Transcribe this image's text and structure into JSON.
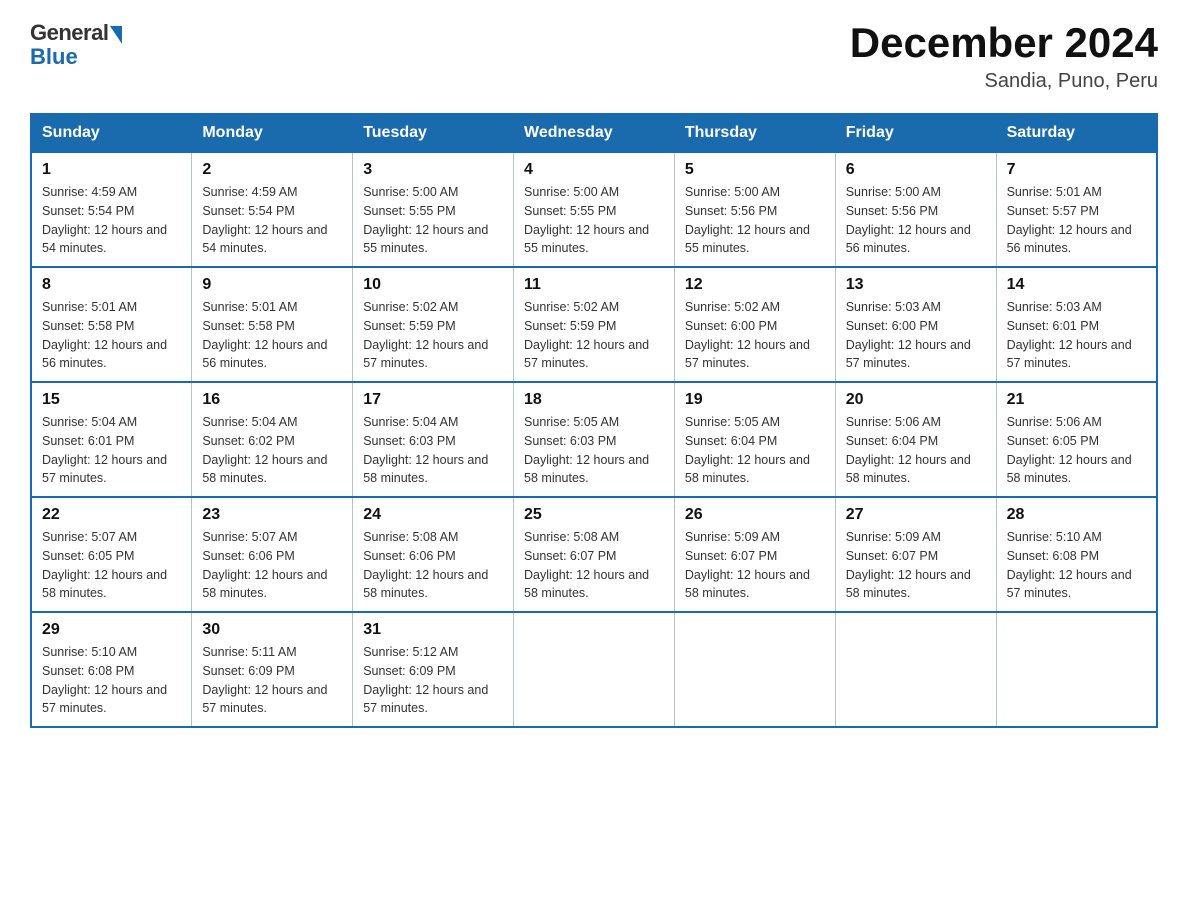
{
  "logo": {
    "text_general": "General",
    "text_blue": "Blue"
  },
  "title": "December 2024",
  "subtitle": "Sandia, Puno, Peru",
  "days_of_week": [
    "Sunday",
    "Monday",
    "Tuesday",
    "Wednesday",
    "Thursday",
    "Friday",
    "Saturday"
  ],
  "weeks": [
    [
      {
        "day": "1",
        "sunrise": "Sunrise: 4:59 AM",
        "sunset": "Sunset: 5:54 PM",
        "daylight": "Daylight: 12 hours and 54 minutes."
      },
      {
        "day": "2",
        "sunrise": "Sunrise: 4:59 AM",
        "sunset": "Sunset: 5:54 PM",
        "daylight": "Daylight: 12 hours and 54 minutes."
      },
      {
        "day": "3",
        "sunrise": "Sunrise: 5:00 AM",
        "sunset": "Sunset: 5:55 PM",
        "daylight": "Daylight: 12 hours and 55 minutes."
      },
      {
        "day": "4",
        "sunrise": "Sunrise: 5:00 AM",
        "sunset": "Sunset: 5:55 PM",
        "daylight": "Daylight: 12 hours and 55 minutes."
      },
      {
        "day": "5",
        "sunrise": "Sunrise: 5:00 AM",
        "sunset": "Sunset: 5:56 PM",
        "daylight": "Daylight: 12 hours and 55 minutes."
      },
      {
        "day": "6",
        "sunrise": "Sunrise: 5:00 AM",
        "sunset": "Sunset: 5:56 PM",
        "daylight": "Daylight: 12 hours and 56 minutes."
      },
      {
        "day": "7",
        "sunrise": "Sunrise: 5:01 AM",
        "sunset": "Sunset: 5:57 PM",
        "daylight": "Daylight: 12 hours and 56 minutes."
      }
    ],
    [
      {
        "day": "8",
        "sunrise": "Sunrise: 5:01 AM",
        "sunset": "Sunset: 5:58 PM",
        "daylight": "Daylight: 12 hours and 56 minutes."
      },
      {
        "day": "9",
        "sunrise": "Sunrise: 5:01 AM",
        "sunset": "Sunset: 5:58 PM",
        "daylight": "Daylight: 12 hours and 56 minutes."
      },
      {
        "day": "10",
        "sunrise": "Sunrise: 5:02 AM",
        "sunset": "Sunset: 5:59 PM",
        "daylight": "Daylight: 12 hours and 57 minutes."
      },
      {
        "day": "11",
        "sunrise": "Sunrise: 5:02 AM",
        "sunset": "Sunset: 5:59 PM",
        "daylight": "Daylight: 12 hours and 57 minutes."
      },
      {
        "day": "12",
        "sunrise": "Sunrise: 5:02 AM",
        "sunset": "Sunset: 6:00 PM",
        "daylight": "Daylight: 12 hours and 57 minutes."
      },
      {
        "day": "13",
        "sunrise": "Sunrise: 5:03 AM",
        "sunset": "Sunset: 6:00 PM",
        "daylight": "Daylight: 12 hours and 57 minutes."
      },
      {
        "day": "14",
        "sunrise": "Sunrise: 5:03 AM",
        "sunset": "Sunset: 6:01 PM",
        "daylight": "Daylight: 12 hours and 57 minutes."
      }
    ],
    [
      {
        "day": "15",
        "sunrise": "Sunrise: 5:04 AM",
        "sunset": "Sunset: 6:01 PM",
        "daylight": "Daylight: 12 hours and 57 minutes."
      },
      {
        "day": "16",
        "sunrise": "Sunrise: 5:04 AM",
        "sunset": "Sunset: 6:02 PM",
        "daylight": "Daylight: 12 hours and 58 minutes."
      },
      {
        "day": "17",
        "sunrise": "Sunrise: 5:04 AM",
        "sunset": "Sunset: 6:03 PM",
        "daylight": "Daylight: 12 hours and 58 minutes."
      },
      {
        "day": "18",
        "sunrise": "Sunrise: 5:05 AM",
        "sunset": "Sunset: 6:03 PM",
        "daylight": "Daylight: 12 hours and 58 minutes."
      },
      {
        "day": "19",
        "sunrise": "Sunrise: 5:05 AM",
        "sunset": "Sunset: 6:04 PM",
        "daylight": "Daylight: 12 hours and 58 minutes."
      },
      {
        "day": "20",
        "sunrise": "Sunrise: 5:06 AM",
        "sunset": "Sunset: 6:04 PM",
        "daylight": "Daylight: 12 hours and 58 minutes."
      },
      {
        "day": "21",
        "sunrise": "Sunrise: 5:06 AM",
        "sunset": "Sunset: 6:05 PM",
        "daylight": "Daylight: 12 hours and 58 minutes."
      }
    ],
    [
      {
        "day": "22",
        "sunrise": "Sunrise: 5:07 AM",
        "sunset": "Sunset: 6:05 PM",
        "daylight": "Daylight: 12 hours and 58 minutes."
      },
      {
        "day": "23",
        "sunrise": "Sunrise: 5:07 AM",
        "sunset": "Sunset: 6:06 PM",
        "daylight": "Daylight: 12 hours and 58 minutes."
      },
      {
        "day": "24",
        "sunrise": "Sunrise: 5:08 AM",
        "sunset": "Sunset: 6:06 PM",
        "daylight": "Daylight: 12 hours and 58 minutes."
      },
      {
        "day": "25",
        "sunrise": "Sunrise: 5:08 AM",
        "sunset": "Sunset: 6:07 PM",
        "daylight": "Daylight: 12 hours and 58 minutes."
      },
      {
        "day": "26",
        "sunrise": "Sunrise: 5:09 AM",
        "sunset": "Sunset: 6:07 PM",
        "daylight": "Daylight: 12 hours and 58 minutes."
      },
      {
        "day": "27",
        "sunrise": "Sunrise: 5:09 AM",
        "sunset": "Sunset: 6:07 PM",
        "daylight": "Daylight: 12 hours and 58 minutes."
      },
      {
        "day": "28",
        "sunrise": "Sunrise: 5:10 AM",
        "sunset": "Sunset: 6:08 PM",
        "daylight": "Daylight: 12 hours and 57 minutes."
      }
    ],
    [
      {
        "day": "29",
        "sunrise": "Sunrise: 5:10 AM",
        "sunset": "Sunset: 6:08 PM",
        "daylight": "Daylight: 12 hours and 57 minutes."
      },
      {
        "day": "30",
        "sunrise": "Sunrise: 5:11 AM",
        "sunset": "Sunset: 6:09 PM",
        "daylight": "Daylight: 12 hours and 57 minutes."
      },
      {
        "day": "31",
        "sunrise": "Sunrise: 5:12 AM",
        "sunset": "Sunset: 6:09 PM",
        "daylight": "Daylight: 12 hours and 57 minutes."
      },
      null,
      null,
      null,
      null
    ]
  ]
}
